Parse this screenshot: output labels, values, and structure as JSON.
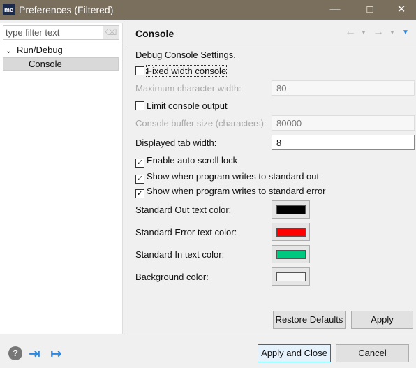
{
  "window": {
    "title": "Preferences (Filtered)",
    "logo": "me"
  },
  "sidebar": {
    "filter_placeholder": "type filter text",
    "tree": [
      {
        "label": "Run/Debug",
        "expanded": true
      },
      {
        "label": "Console",
        "selected": true
      }
    ]
  },
  "page": {
    "title": "Console",
    "description": "Debug Console Settings.",
    "fixed_width": {
      "label": "Fixed width console",
      "checked": false
    },
    "max_width": {
      "label": "Maximum character width:",
      "value": "80",
      "enabled": false
    },
    "limit_output": {
      "label": "Limit console output",
      "checked": false
    },
    "buffer_size": {
      "label": "Console buffer size (characters):",
      "value": "80000",
      "enabled": false
    },
    "tab_width": {
      "label": "Displayed tab width:",
      "value": "8"
    },
    "auto_scroll": {
      "label": "Enable auto scroll lock",
      "checked": true
    },
    "show_out": {
      "label": "Show when program writes to standard out",
      "checked": true
    },
    "show_err": {
      "label": "Show when program writes to standard error",
      "checked": true
    },
    "colors": [
      {
        "label": "Standard Out text color:",
        "color": "#000000"
      },
      {
        "label": "Standard Error text color:",
        "color": "#ff0000"
      },
      {
        "label": "Standard In text color:",
        "color": "#00c87f"
      },
      {
        "label": "Background color:",
        "color": "#f5f5f5"
      }
    ],
    "restore_defaults": "Restore Defaults",
    "apply": "Apply"
  },
  "footer": {
    "apply_close": "Apply and Close",
    "cancel": "Cancel"
  }
}
